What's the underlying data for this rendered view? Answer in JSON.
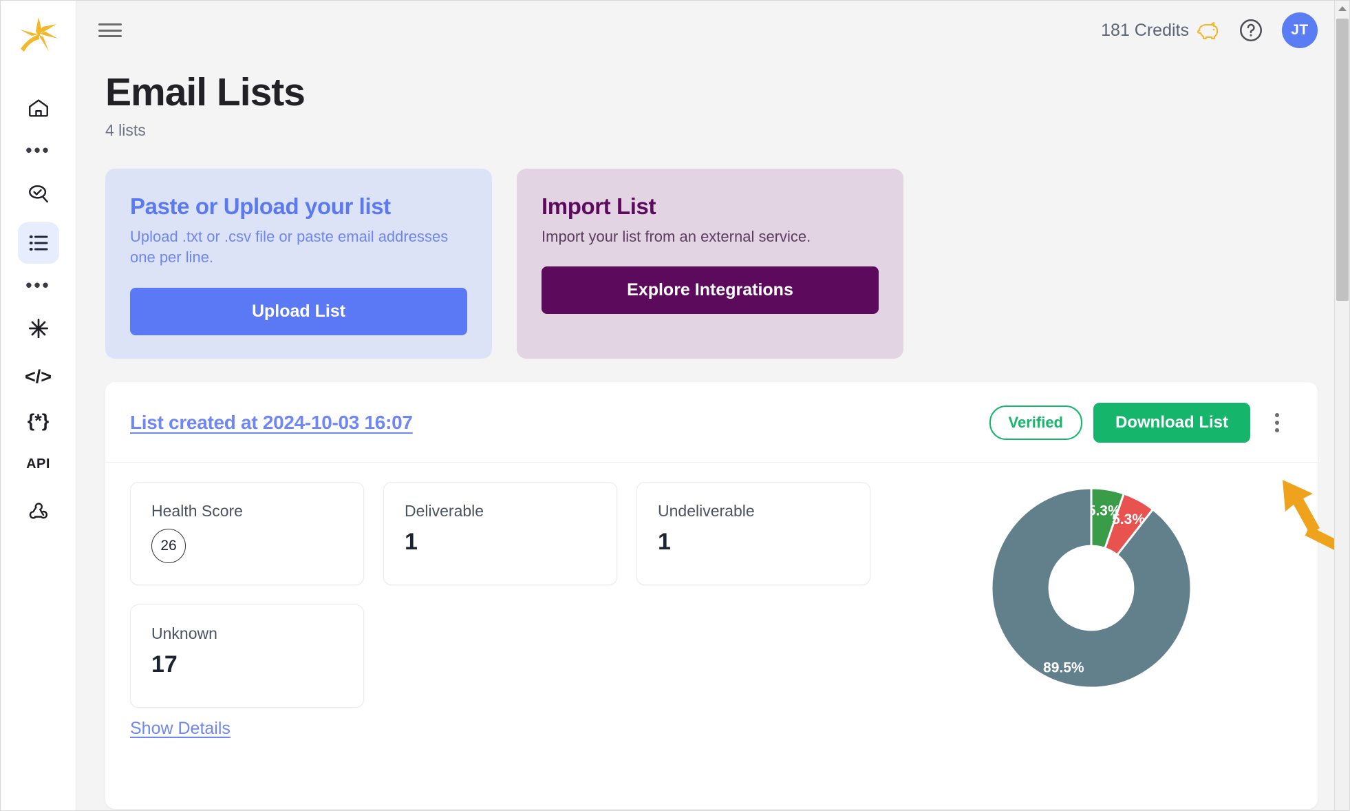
{
  "sidebar": {
    "logo": "brand-logo",
    "items": [
      {
        "icon": "home-icon",
        "name": "home",
        "label": "",
        "active": false
      },
      {
        "icon": "ellipsis-icon",
        "name": "more-1",
        "label": "•••",
        "active": false
      },
      {
        "icon": "email-verify-search-icon",
        "name": "verify",
        "label": "",
        "active": false
      },
      {
        "icon": "list-icon",
        "name": "email-lists",
        "label": "",
        "active": true
      },
      {
        "icon": "ellipsis-icon",
        "name": "more-2",
        "label": "•••",
        "active": false
      },
      {
        "icon": "asterisk-icon",
        "name": "integrations",
        "label": "",
        "active": false
      },
      {
        "icon": "code-icon",
        "name": "code",
        "label": "</>",
        "active": false
      },
      {
        "icon": "braces-icon",
        "name": "variables",
        "label": "{*}",
        "active": false
      },
      {
        "icon": "api-icon",
        "name": "api",
        "label": "API",
        "active": false
      },
      {
        "icon": "webhook-icon",
        "name": "webhooks",
        "label": "",
        "active": false
      }
    ]
  },
  "topbar": {
    "menu_icon": "hamburger-icon",
    "credits_label": "181 Credits",
    "credits_icon": "piggy-bank-icon",
    "help_icon": "help-circle-icon",
    "avatar_initials": "JT"
  },
  "page": {
    "title": "Email Lists",
    "subtitle": "4 lists"
  },
  "action_cards": [
    {
      "title": "Paste or Upload your list",
      "description": "Upload .txt or .csv file or paste email addresses one per line.",
      "button_label": "Upload List",
      "bg": "#dde3f7",
      "accent": "#5b79f5"
    },
    {
      "title": "Import List",
      "description": "Import your list from an external service.",
      "button_label": "Explore Integrations",
      "bg": "#e3d4e4",
      "accent": "#5c0a5c"
    }
  ],
  "list": {
    "link_label": "List created at 2024-10-03 16:07",
    "status_badge": "Verified",
    "download_label": "Download List",
    "menu_icon": "kebab-menu-icon",
    "show_details_label": "Show Details",
    "stats": [
      {
        "label": "Health Score",
        "value": "26",
        "style": "circle"
      },
      {
        "label": "Deliverable",
        "value": "1",
        "style": "plain"
      },
      {
        "label": "Undeliverable",
        "value": "1",
        "style": "plain"
      },
      {
        "label": "Unknown",
        "value": "17",
        "style": "plain"
      }
    ]
  },
  "chart_data": {
    "type": "pie",
    "title": "",
    "variant": "donut",
    "labels": [
      "Deliverable",
      "Undeliverable",
      "Unknown"
    ],
    "values": [
      5.3,
      5.3,
      89.5
    ],
    "value_labels": [
      "5.3%",
      "5.3%",
      "89.5%"
    ],
    "colors": [
      "#3a9c48",
      "#e8524f",
      "#62808c"
    ],
    "legend": false,
    "inner_radius_ratio": 0.42,
    "start_angle": 0
  },
  "annotation": {
    "arrow_color": "#efa31d",
    "points_to": "download-list-button"
  },
  "scrollbar": {
    "orientation": "vertical",
    "up_arrow_icon": "scroll-up-arrow-icon"
  }
}
